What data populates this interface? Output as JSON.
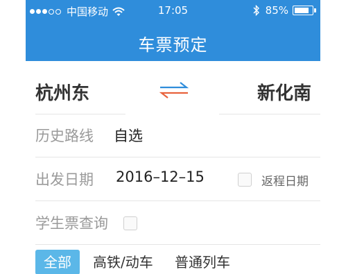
{
  "status_bar": {
    "carrier": "中国移动",
    "time": "17:05",
    "battery_percent": "85%",
    "battery_level": 0.85,
    "signal_bars_filled": 3,
    "signal_bars_total": 5
  },
  "navbar": {
    "title": "车票预定"
  },
  "route": {
    "from": "杭州东",
    "to": "新化南",
    "swap_icon": "swap-arrows-icon"
  },
  "history": {
    "label": "历史路线",
    "value": "自选"
  },
  "departure": {
    "label": "出发日期",
    "value": "2016–12–15",
    "return_label": "返程日期",
    "return_checked": false
  },
  "student": {
    "label": "学生票查询",
    "checked": false
  },
  "filters": {
    "tabs": [
      {
        "label": "全部",
        "active": true
      },
      {
        "label": "高铁/动车",
        "active": false
      },
      {
        "label": "普通列车",
        "active": false
      }
    ]
  },
  "colors": {
    "header": "#2f8ddb",
    "active_tab": "#5bb7e8",
    "swap_top": "#2f8ddb",
    "swap_bottom": "#e8623c"
  }
}
